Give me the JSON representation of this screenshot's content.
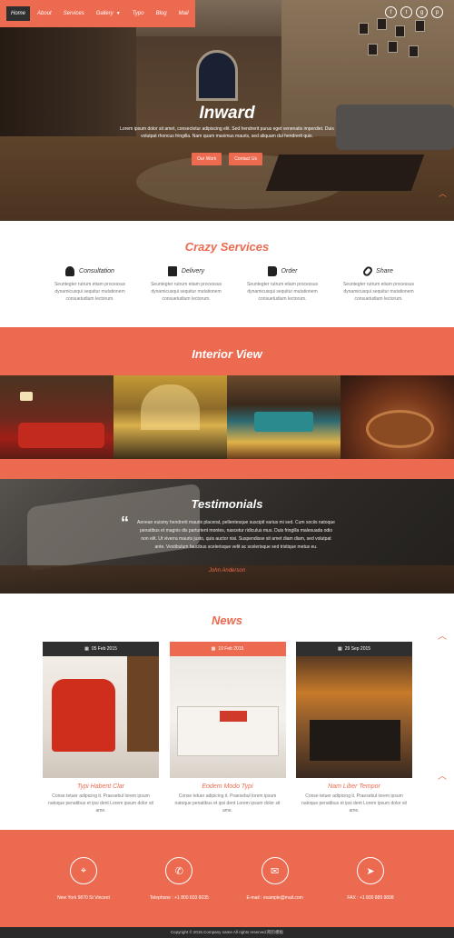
{
  "nav": {
    "items": [
      {
        "label": "Home"
      },
      {
        "label": "About"
      },
      {
        "label": "Services"
      },
      {
        "label": "Gallery"
      },
      {
        "label": "Typo"
      },
      {
        "label": "Blog"
      },
      {
        "label": "Mail"
      }
    ],
    "active": "Home"
  },
  "social": [
    "f",
    "t",
    "g",
    "p"
  ],
  "hero": {
    "title": "Inward",
    "text": "Lorem ipsum dolor sit amet, consectetur adipiscing elit. Sed hendrerit purus eget venenatis imperdiet. Duis volutpat rhoncus fringilla. Nam quam maximus mauris, sed aliquam dui hendrerit quis.",
    "btn_work": "Our Work",
    "btn_contact": "Contact Us"
  },
  "services": {
    "title": "Crazy Services",
    "items": [
      {
        "label": "Consultation",
        "text": "Seuntegter rutrum etiam processus dynamicusqui sequitur mutationem consuetudium lectorum."
      },
      {
        "label": "Delivery",
        "text": "Seuntegter rutrum etiam processus dynamicusqui sequitur mutationem consuetudium lectorum."
      },
      {
        "label": "Order",
        "text": "Seuntegter rutrum etiam processus dynamicusqui sequitur mutationem consuetudium lectorum."
      },
      {
        "label": "Share",
        "text": "Seuntegter rutrum etiam processus dynamicusqui sequitur mutationem consuetudium lectorum."
      }
    ]
  },
  "interior": {
    "title": "Interior View"
  },
  "testimonials": {
    "title": "Testimonials",
    "quote": "Aenean euismy hendrerit mauris placerat, pellentesque suscipit varius mi sed. Cum sociis natoque penatibus et magnis dis parturient montes, nascetur ridiculus mus. Duis fringilla malesuada odio non elit. Ut viverra mauris justo, quis auctor nisi. Suspendisse sit amet diam diam, sed volutpat ante. Vestibulum faucibus scelerisque velit ac scelerisque sed tristique metus eu.",
    "author": "John Anderson"
  },
  "news": {
    "title": "News",
    "items": [
      {
        "date": "05 Feb 2015",
        "title": "Typi Habent Clar",
        "text": "Conse tetuer adipicing it. Praesebul lorem ipsum natoque penatibus et ipsi dent Lorem ipsum dolor sit ame."
      },
      {
        "date": "19 Feb 2015",
        "title": "Eodem Modo Typi",
        "text": "Conse tetuer adipicing it. Praesebul lorem ipsum natoque penatibus et ipsi dent Lorem ipsum dolor sit ame."
      },
      {
        "date": "29 Sep 2015",
        "title": "Nam Liber Tempor",
        "text": "Conse tetuer adipicing it. Praesebul lorem ipsum natoque penatibus et ipsi dent Lorem ipsum dolor sit ame."
      }
    ]
  },
  "contact": {
    "items": [
      {
        "icon": "map-marker-icon",
        "glyph": "⌖",
        "text": "New York 9870 St Vincent"
      },
      {
        "icon": "phone-icon",
        "glyph": "✆",
        "text": "Telephone : +1 800 603 6035"
      },
      {
        "icon": "envelope-icon",
        "glyph": "✉",
        "text": "E-mail : example@mail.com"
      },
      {
        "icon": "send-icon",
        "glyph": "➤",
        "text": "FAX : +1 800 889 9898"
      }
    ]
  },
  "footer": {
    "text": "Copyright © 2015.Company name All rights reserved.网页模板"
  },
  "colors": {
    "accent": "#ec6a50",
    "dark": "#2f2f2f"
  }
}
